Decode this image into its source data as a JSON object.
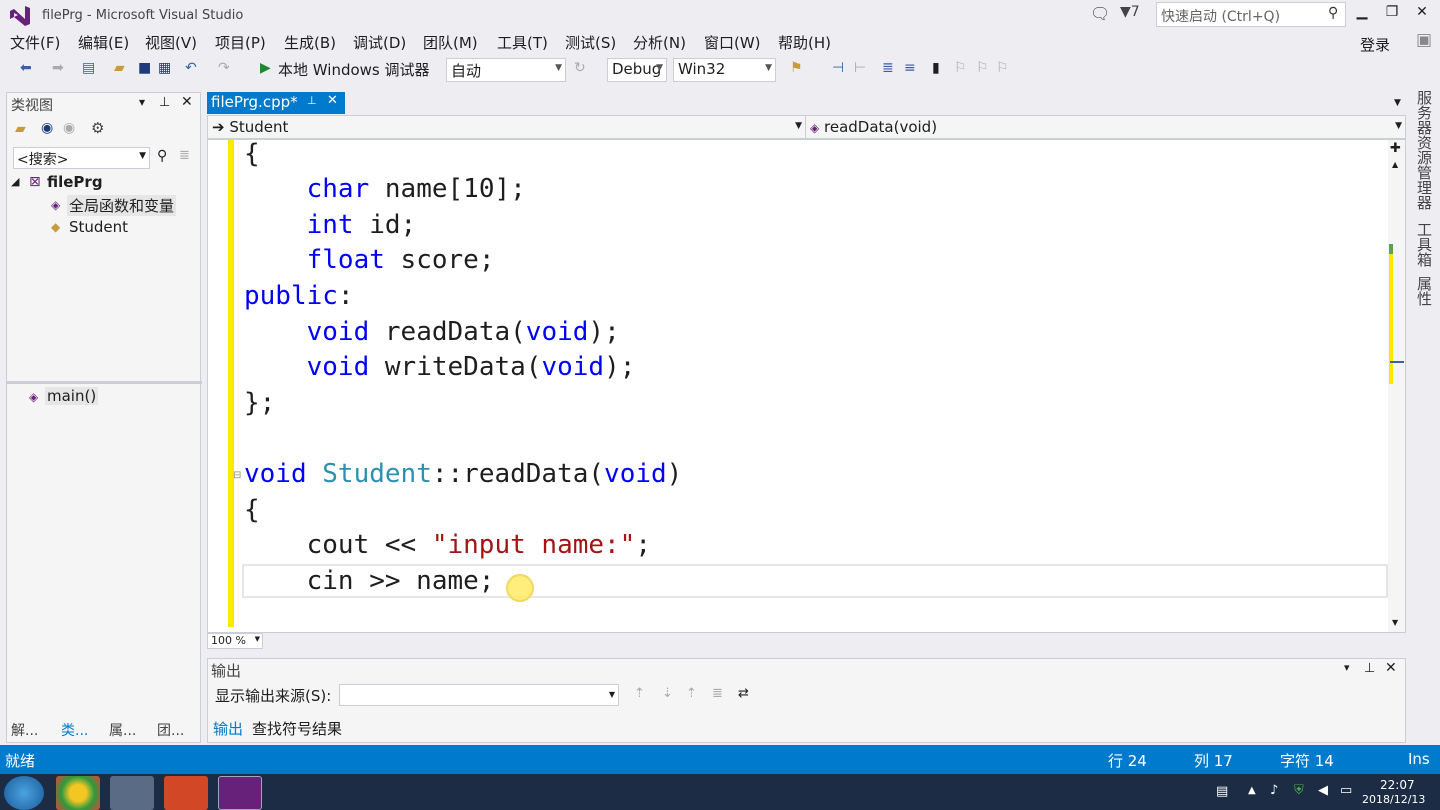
{
  "window": {
    "title": "filePrg - Microsoft Visual Studio",
    "notif_count": "7",
    "quick_launch_placeholder": "快速启动 (Ctrl+Q)"
  },
  "menu": [
    "文件(F)",
    "编辑(E)",
    "视图(V)",
    "项目(P)",
    "生成(B)",
    "调试(D)",
    "团队(M)",
    "工具(T)",
    "测试(S)",
    "分析(N)",
    "窗口(W)",
    "帮助(H)"
  ],
  "account": {
    "login": "登录"
  },
  "toolbar": {
    "debugger_label": "本地 Windows 调试器",
    "config_auto": "自动",
    "config": "Debug",
    "platform": "Win32"
  },
  "class_view": {
    "title": "类视图",
    "search_placeholder": "<搜索>",
    "tree": {
      "project": "filePrg",
      "globals": "全局函数和变量",
      "student": "Student"
    },
    "members": [
      "main()"
    ],
    "bottom_tabs": [
      "解...",
      "类...",
      "属...",
      "团..."
    ]
  },
  "editor": {
    "tab_label": "filePrg.cpp*",
    "nav_left": "Student",
    "nav_right": "readData(void)",
    "zoom": "100 %",
    "code": [
      "{",
      "    char name[10];",
      "    int id;",
      "    float score;",
      "public:",
      "    void readData(void);",
      "    void writeData(void);",
      "};",
      "",
      "void Student::readData(void)",
      "{",
      "    cout << \"input name:\";",
      "    cin >> name;"
    ]
  },
  "output": {
    "title": "输出",
    "source_label": "显示输出来源(S):",
    "tabs": [
      "输出",
      "查找符号结果"
    ]
  },
  "right_tabs": [
    "服务器资源管理器",
    "工具箱",
    "属性"
  ],
  "status": {
    "ready": "就绪",
    "line": "行 24",
    "col": "列 17",
    "char": "字符 14",
    "mode": "Ins"
  },
  "clock": {
    "time": "22:07",
    "date": "2018/12/13"
  },
  "colors": {
    "accent": "#007acc",
    "keyword": "#0000ff",
    "type": "#2b91af",
    "string": "#a31515",
    "change_bar": "#fbe900"
  }
}
